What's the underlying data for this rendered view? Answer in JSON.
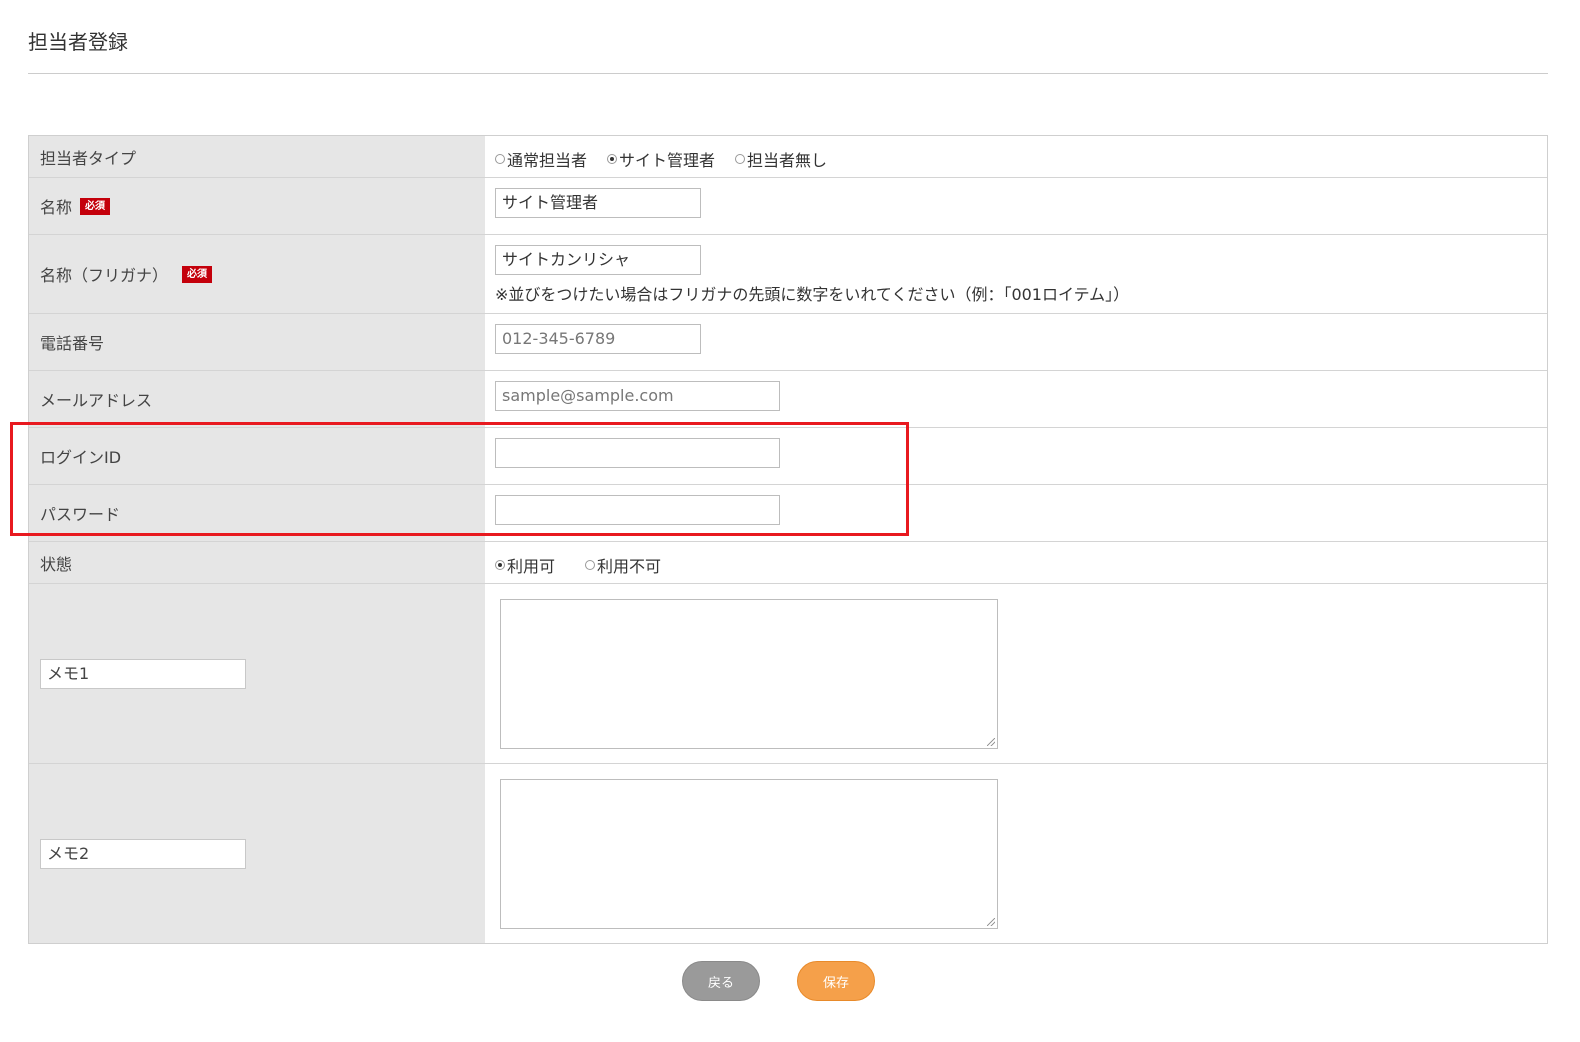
{
  "page": {
    "title": "担当者登録"
  },
  "form": {
    "type_row": {
      "label": "担当者タイプ",
      "options": [
        {
          "label": "通常担当者",
          "checked": false
        },
        {
          "label": "サイト管理者",
          "checked": true
        },
        {
          "label": "担当者無し",
          "checked": false
        }
      ]
    },
    "name_row": {
      "label": "名称",
      "required": "必須",
      "value": "サイト管理者"
    },
    "kana_row": {
      "label": "名称（フリガナ）",
      "required": "必須",
      "value": "サイトカンリシャ",
      "note": "※並びをつけたい場合はフリガナの先頭に数字をいれてください（例：「001ロイテム」）"
    },
    "phone_row": {
      "label": "電話番号",
      "placeholder": "012-345-6789"
    },
    "email_row": {
      "label": "メールアドレス",
      "placeholder": "sample@sample.com"
    },
    "login_row": {
      "label": "ログインID",
      "value": ""
    },
    "password_row": {
      "label": "パスワード",
      "value": ""
    },
    "status_row": {
      "label": "状態",
      "options": [
        {
          "label": "利用可",
          "checked": true
        },
        {
          "label": "利用不可",
          "checked": false
        }
      ]
    },
    "memo1_row": {
      "label_value": "メモ1",
      "value": ""
    },
    "memo2_row": {
      "label_value": "メモ2",
      "value": ""
    }
  },
  "buttons": {
    "back_label": "戻る",
    "save_label": "保存"
  },
  "colors": {
    "required_badge": "#c4000b",
    "highlight": "#e8191f",
    "save_button": "#f5a04a",
    "back_button": "#9a9a9a"
  }
}
